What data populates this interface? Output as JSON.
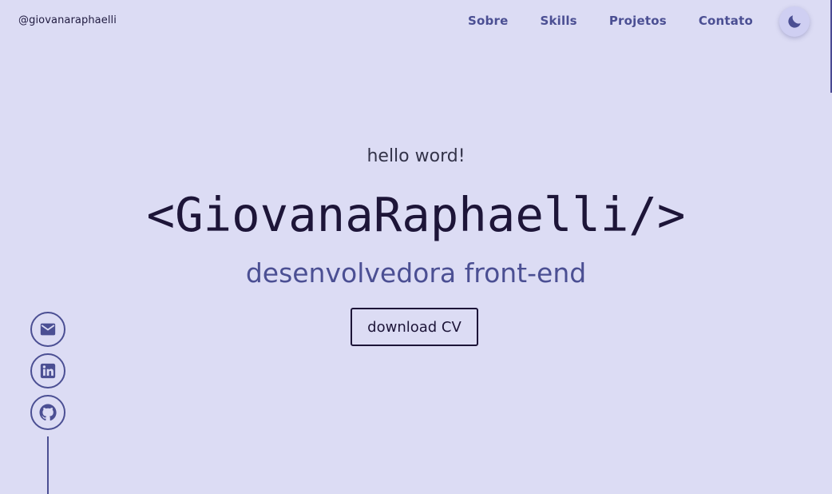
{
  "header": {
    "handle": "@giovanaraphaelli",
    "nav": [
      "Sobre",
      "Skills",
      "Projetos",
      "Contato"
    ],
    "theme_toggle_icon": "moon-icon"
  },
  "hero": {
    "greeting": "hello word!",
    "name": "<GiovanaRaphaelli/>",
    "role": "desenvolvedora front-end",
    "cv_button": "download CV"
  },
  "social": {
    "icons": [
      "mail-icon",
      "linkedin-icon",
      "github-icon"
    ]
  },
  "colors": {
    "background": "#dcdcf4",
    "accent": "#4b4f93",
    "text_dark": "#1d1538"
  }
}
